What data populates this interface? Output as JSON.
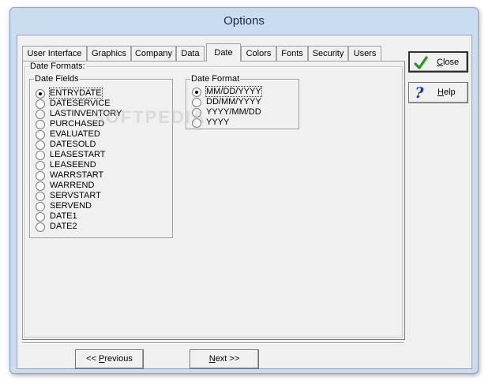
{
  "window": {
    "title": "Options"
  },
  "tabs": [
    {
      "label": "User Interface"
    },
    {
      "label": "Graphics"
    },
    {
      "label": "Company"
    },
    {
      "label": "Data"
    },
    {
      "label": "Date",
      "active": true
    },
    {
      "label": "Colors"
    },
    {
      "label": "Fonts"
    },
    {
      "label": "Security"
    },
    {
      "label": "Users"
    }
  ],
  "date_formats_group": {
    "label": "Date Formats:"
  },
  "date_fields": {
    "label": "Date Fields",
    "selected": "ENTRYDATE",
    "items": [
      "ENTRYDATE",
      "DATESERVICE",
      "LASTINVENTORY",
      "PURCHASED",
      "EVALUATED",
      "DATESOLD",
      "LEASESTART",
      "LEASEEND",
      "WARRSTART",
      "WARREND",
      "SERVSTART",
      "SERVEND",
      "DATE1",
      "DATE2"
    ]
  },
  "date_format": {
    "label": "Date Format",
    "selected": "MM/DD/YYYY",
    "items": [
      "MM/DD/YYYY",
      "DD/MM/YYYY",
      "YYYY/MM/DD",
      "YYYY"
    ]
  },
  "buttons": {
    "close": {
      "mnemonic": "C",
      "rest": "lose"
    },
    "help": {
      "mnemonic": "H",
      "rest": "elp"
    },
    "previous": {
      "prefix": "<< ",
      "mnemonic": "P",
      "rest": "revious"
    },
    "next": {
      "mnemonic": "N",
      "rest": "ext >>"
    }
  },
  "colors": {
    "accent_check": "#1a9a1a",
    "help_icon": "#1a35a8"
  }
}
